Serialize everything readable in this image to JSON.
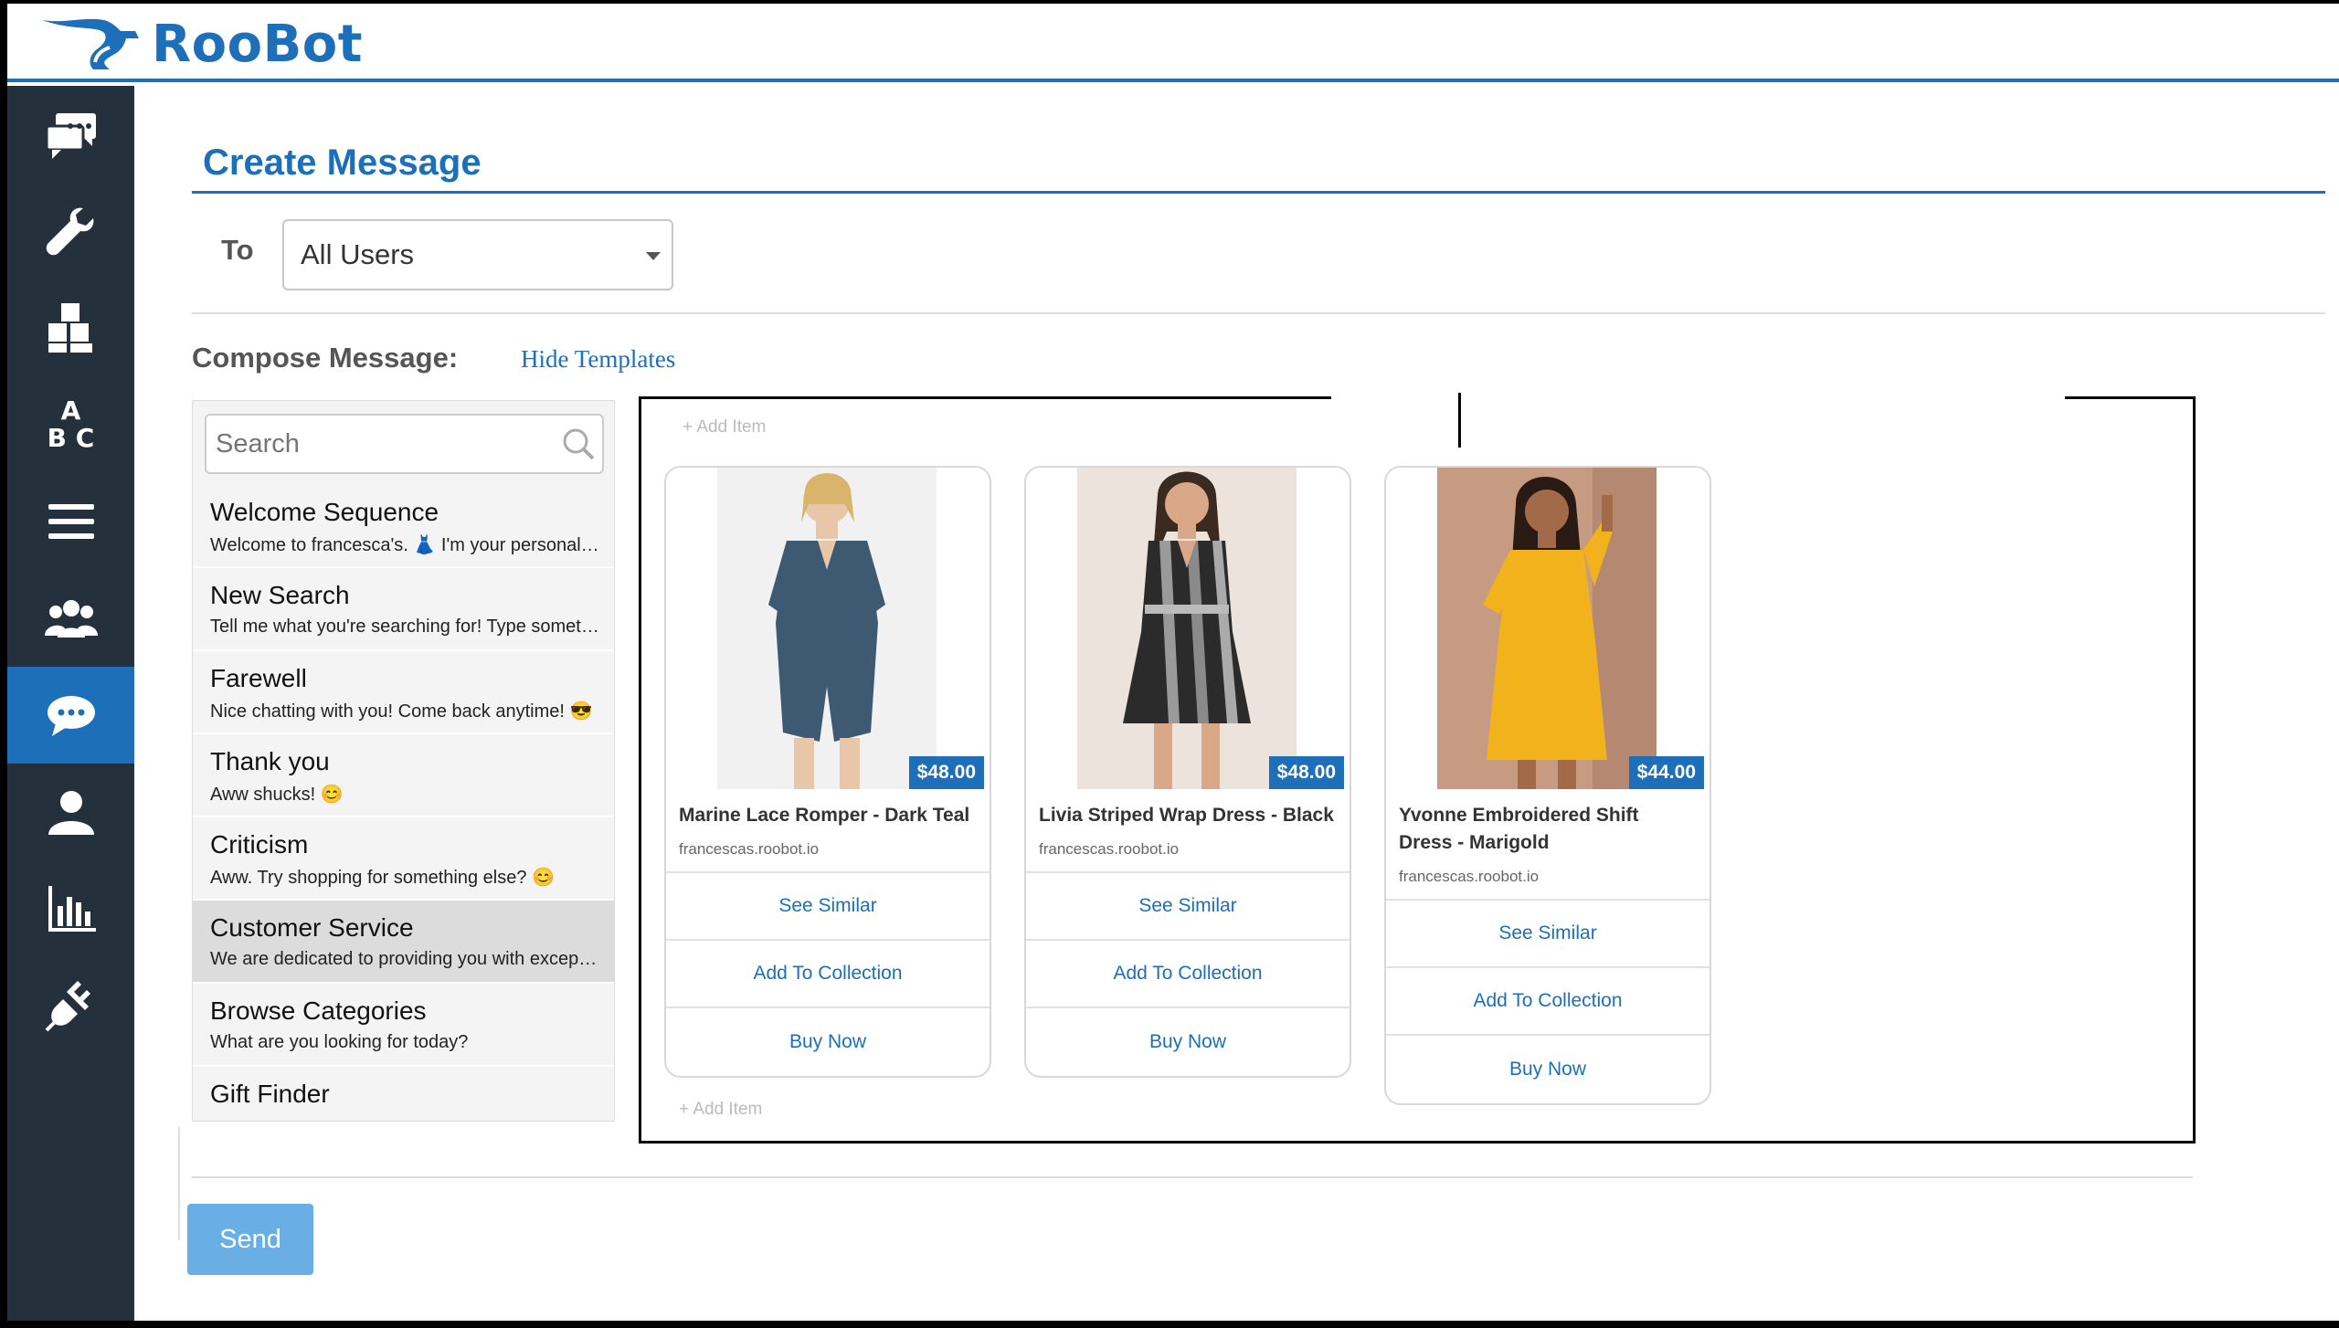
{
  "app": {
    "name": "RooBot"
  },
  "sidebar": {
    "items": [
      {
        "icon": "chat-bubbles-icon"
      },
      {
        "icon": "wrench-icon"
      },
      {
        "icon": "blocks-icon"
      },
      {
        "icon": "abc-icon",
        "glyph_a": "A",
        "glyph_bc": "B C"
      },
      {
        "icon": "menu-icon"
      },
      {
        "icon": "users-icon"
      },
      {
        "icon": "message-icon",
        "active": true
      },
      {
        "icon": "user-icon"
      },
      {
        "icon": "analytics-icon"
      },
      {
        "icon": "plugin-icon"
      }
    ]
  },
  "page": {
    "title": "Create Message"
  },
  "recipient": {
    "label": "To",
    "selected": "All Users"
  },
  "compose": {
    "label": "Compose Message:",
    "hide_templates": "Hide Templates"
  },
  "templates": {
    "search_placeholder": "Search",
    "items": [
      {
        "name": "Welcome Sequence",
        "preview": "Welcome to francesca's. 👗 I'm your personal shopping assistant"
      },
      {
        "name": "New Search",
        "preview": "Tell me what you're searching for! Type something like"
      },
      {
        "name": "Farewell",
        "preview": "Nice chatting with you! Come back anytime! 😎"
      },
      {
        "name": "Thank you",
        "preview": "Aww shucks! 😊"
      },
      {
        "name": "Criticism",
        "preview": "Aww. Try shopping for something else? 😊"
      },
      {
        "name": "Customer Service",
        "preview": "We are dedicated to providing you with exceptional service",
        "selected": true
      },
      {
        "name": "Browse Categories",
        "preview": "What are you looking for today?"
      },
      {
        "name": "Gift Finder",
        "preview": ""
      }
    ]
  },
  "canvas": {
    "add_item_top": "+ Add Item",
    "add_item_bottom": "+ Add Item"
  },
  "products": [
    {
      "name": "Marine Lace Romper - Dark Teal",
      "price": "$48.00",
      "domain": "francescas.roobot.io",
      "see_similar": "See Similar",
      "add_to_collection": "Add To Collection",
      "buy_now": "Buy Now",
      "color": "#3d5a72",
      "bg": "#f1f1f1"
    },
    {
      "name": "Livia Striped Wrap Dress - Black",
      "price": "$48.00",
      "domain": "francescas.roobot.io",
      "see_similar": "See Similar",
      "add_to_collection": "Add To Collection",
      "buy_now": "Buy Now",
      "color": "#2b2b2b",
      "bg": "#ece4dc"
    },
    {
      "name": "Yvonne Embroidered Shift Dress - Marigold",
      "price": "$44.00",
      "domain": "francescas.roobot.io",
      "see_similar": "See Similar",
      "add_to_collection": "Add To Collection",
      "buy_now": "Buy Now",
      "color": "#f2b21c",
      "bg": "#c79a82"
    }
  ],
  "send": {
    "label": "Send"
  },
  "colors": {
    "brand": "#1c6fb8",
    "sidebar": "#24313d",
    "send": "#6aaee6"
  }
}
